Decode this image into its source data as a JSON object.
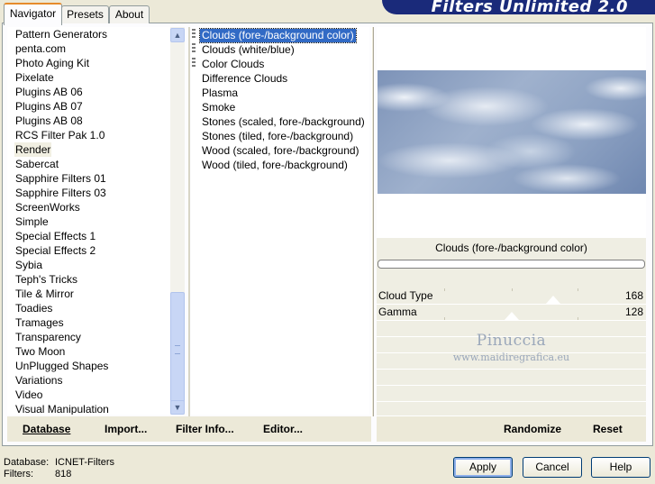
{
  "tabs": [
    {
      "label": "Navigator",
      "active": true
    },
    {
      "label": "Presets",
      "active": false
    },
    {
      "label": "About",
      "active": false
    }
  ],
  "banner_title": "Filters Unlimited 2.0",
  "categories": [
    "Pattern Generators",
    "penta.com",
    "Photo Aging Kit",
    "Pixelate",
    "Plugins AB 06",
    "Plugins AB 07",
    "Plugins AB 08",
    "RCS Filter Pak 1.0",
    "Render",
    "Sabercat",
    "Sapphire Filters 01",
    "Sapphire Filters 03",
    "ScreenWorks",
    "Simple",
    "Special Effects 1",
    "Special Effects 2",
    "Sybia",
    "Teph's Tricks",
    "Tile & Mirror",
    "Toadies",
    "Tramages",
    "Transparency",
    "Two Moon",
    "UnPlugged Shapes",
    "Variations",
    "Video",
    "Visual Manipulation"
  ],
  "selected_category": "Render",
  "filters": [
    "Clouds (fore-/background color)",
    "Clouds (white/blue)",
    "Color Clouds",
    "Difference Clouds",
    "Plasma",
    "Smoke",
    "Stones (scaled, fore-/background)",
    "Stones (tiled, fore-/background)",
    "Wood (scaled, fore-/background)",
    "Wood (tiled, fore-/background)"
  ],
  "selected_filter": "Clouds (fore-/background color)",
  "preview": {
    "filter_name": "Clouds (fore-/background color)",
    "controls": [
      {
        "label": "Cloud Type",
        "value": "168"
      },
      {
        "label": "Gamma",
        "value": "128"
      }
    ],
    "watermark_line1": "Pinuccia",
    "watermark_line2": "www.maidiregrafica.eu"
  },
  "toolbar": {
    "database": "Database",
    "import": "Import...",
    "filter_info": "Filter Info...",
    "editor": "Editor...",
    "randomize": "Randomize",
    "reset": "Reset"
  },
  "status": {
    "database_label": "Database:",
    "database_value": "ICNET-Filters",
    "filters_label": "Filters:",
    "filters_value": "818"
  },
  "buttons": {
    "apply": "Apply",
    "cancel": "Cancel",
    "help": "Help"
  },
  "icons": {
    "scroll_up": "chevron-up-icon",
    "scroll_down": "chevron-down-icon"
  },
  "colors": {
    "selection": "#316ac5",
    "banner": "#1a2a7a",
    "tab_accent": "#e68b2c"
  }
}
